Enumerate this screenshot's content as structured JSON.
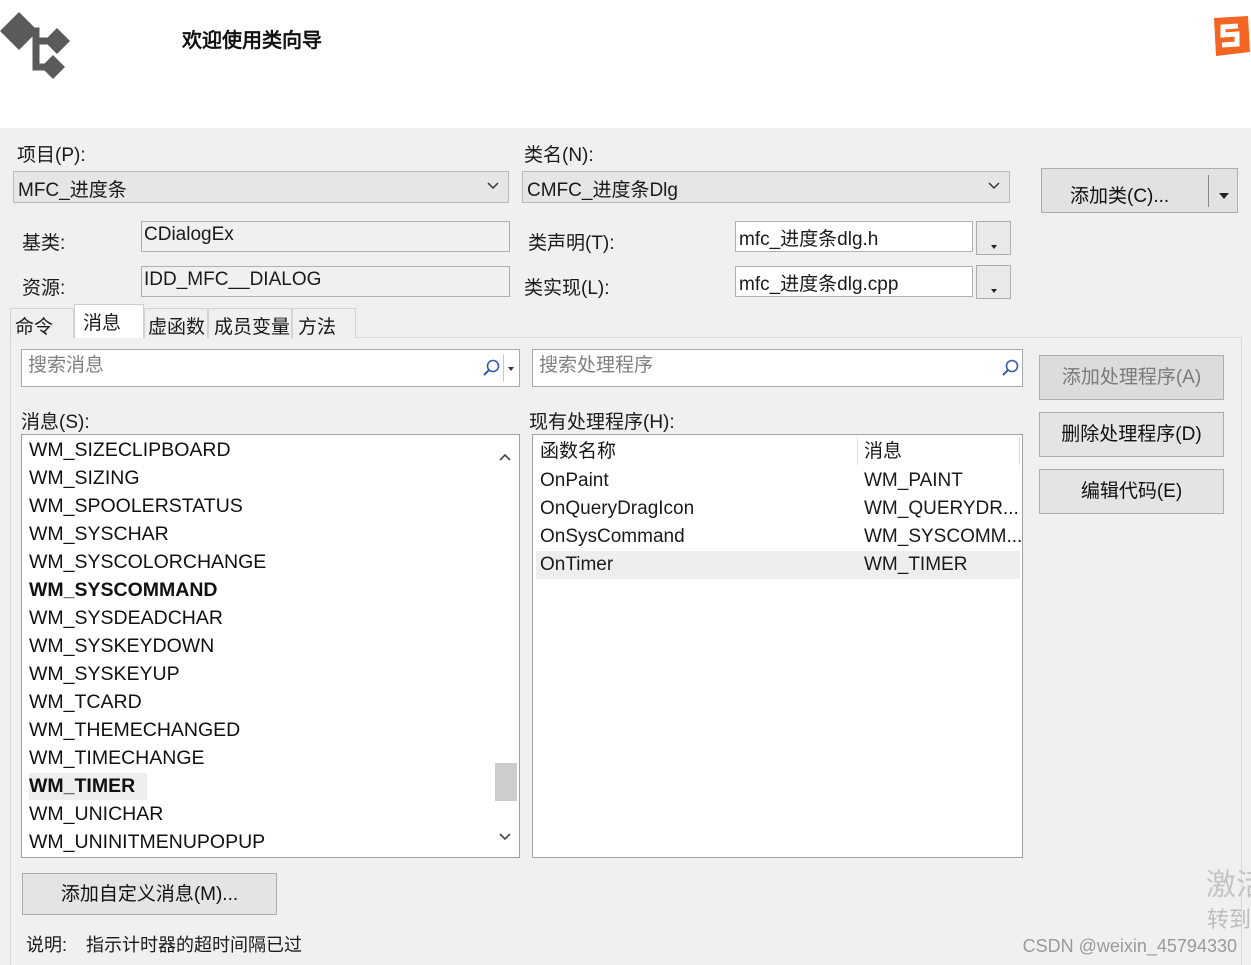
{
  "header": {
    "title": "欢迎使用类向导"
  },
  "form": {
    "project_label": "项目(P):",
    "project_value": "MFC_进度条",
    "classname_label": "类名(N):",
    "classname_value": "CMFC_进度条Dlg",
    "add_class_label": "添加类(C)...",
    "base_class_label": "基类:",
    "base_class_value": "CDialogEx",
    "class_decl_label": "类声明(T):",
    "class_decl_value": "mfc_进度条dlg.h",
    "resource_label": "资源:",
    "resource_value": "IDD_MFC__DIALOG",
    "class_impl_label": "类实现(L):",
    "class_impl_value": "mfc_进度条dlg.cpp"
  },
  "tabs": [
    "命令",
    "消息",
    "虚函数",
    "成员变量",
    "方法"
  ],
  "active_tab": "消息",
  "search": {
    "messages_placeholder": "搜索消息",
    "handlers_placeholder": "搜索处理程序"
  },
  "messages": {
    "label": "消息(S):",
    "items": [
      {
        "text": "WM_SIZECLIPBOARD",
        "bold": false,
        "selected": false
      },
      {
        "text": "WM_SIZING",
        "bold": false,
        "selected": false
      },
      {
        "text": "WM_SPOOLERSTATUS",
        "bold": false,
        "selected": false
      },
      {
        "text": "WM_SYSCHAR",
        "bold": false,
        "selected": false
      },
      {
        "text": "WM_SYSCOLORCHANGE",
        "bold": false,
        "selected": false
      },
      {
        "text": "WM_SYSCOMMAND",
        "bold": true,
        "selected": false
      },
      {
        "text": "WM_SYSDEADCHAR",
        "bold": false,
        "selected": false
      },
      {
        "text": "WM_SYSKEYDOWN",
        "bold": false,
        "selected": false
      },
      {
        "text": "WM_SYSKEYUP",
        "bold": false,
        "selected": false
      },
      {
        "text": "WM_TCARD",
        "bold": false,
        "selected": false
      },
      {
        "text": "WM_THEMECHANGED",
        "bold": false,
        "selected": false
      },
      {
        "text": "WM_TIMECHANGE",
        "bold": false,
        "selected": false
      },
      {
        "text": "WM_TIMER",
        "bold": true,
        "selected": true
      },
      {
        "text": "WM_UNICHAR",
        "bold": false,
        "selected": false
      },
      {
        "text": "WM_UNINITMENUPOPUP",
        "bold": false,
        "selected": false
      }
    ]
  },
  "handlers": {
    "label": "现有处理程序(H):",
    "col_function": "函数名称",
    "col_message": "消息",
    "rows": [
      {
        "function": "OnPaint",
        "message": "WM_PAINT",
        "selected": false
      },
      {
        "function": "OnQueryDragIcon",
        "message": "WM_QUERYDR...",
        "selected": false
      },
      {
        "function": "OnSysCommand",
        "message": "WM_SYSCOMM...",
        "selected": false
      },
      {
        "function": "OnTimer",
        "message": "WM_TIMER",
        "selected": true
      }
    ]
  },
  "buttons": {
    "add_handler": "添加处理程序(A)",
    "delete_handler": "删除处理程序(D)",
    "edit_code": "编辑代码(E)",
    "add_custom_message": "添加自定义消息(M)..."
  },
  "description": {
    "label": "说明:",
    "text": "指示计时器的超时间隔已过"
  },
  "overlay": {
    "activate_text": "激活",
    "goto_text": "转到",
    "watermark": "CSDN @weixin_45794330"
  },
  "colors": {
    "header_bg": "#ffffff",
    "dialog_bg": "#f0f0f0",
    "sogou_orange": "#f26522"
  }
}
